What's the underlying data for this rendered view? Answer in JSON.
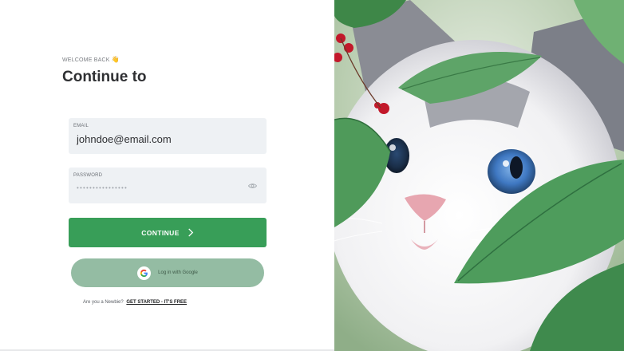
{
  "login": {
    "eyebrow": "WELCOME BACK",
    "wave_emoji": "👋",
    "title": "Continue to",
    "email": {
      "label": "EMAIL",
      "value": "johndoe@email.com"
    },
    "password": {
      "label": "PASSWORD",
      "masked_value": "••••••••••••••••"
    },
    "continue_label": "CONTINUE",
    "google_label": "Log in with Google",
    "signup_prompt": "Are you a Newbie?",
    "signup_link": "GET STARTED - IT'S FREE"
  },
  "colors": {
    "primary": "#389e58",
    "google_button": "#94bca3",
    "field_bg": "#eef1f4"
  },
  "hero": {
    "image_subject": "cat-among-leaves-photo",
    "icon_names": [
      "eye-icon",
      "chevron-right-icon",
      "google-icon",
      "wave-emoji"
    ]
  }
}
